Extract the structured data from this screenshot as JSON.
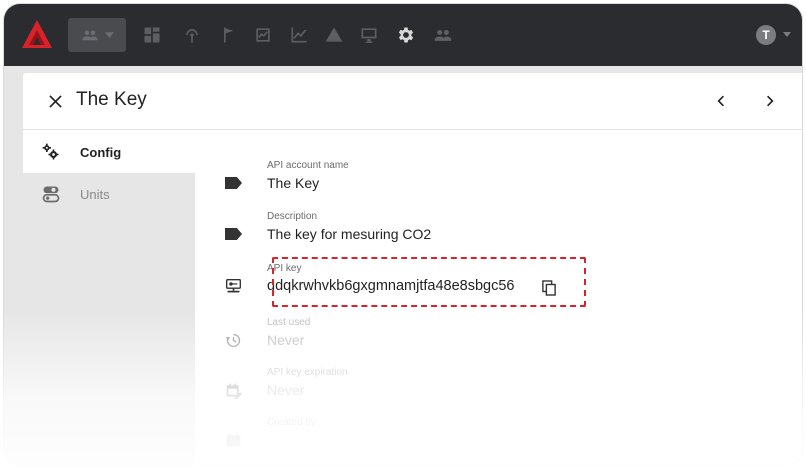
{
  "app": {
    "brand_color": "#d9232a",
    "topbar_color": "#2b2c2f"
  },
  "topbar": {
    "icons": [
      "users-dropdown-icon",
      "dashboard-icon",
      "sensors-icon",
      "flag-icon",
      "chart-box-icon",
      "line-chart-icon",
      "alert-icon",
      "monitor-icon",
      "settings-icon",
      "people-icon"
    ],
    "user_initial": "T"
  },
  "panel": {
    "title": "The Key"
  },
  "sidebar": {
    "items": [
      {
        "label": "Config",
        "icon": "cogs-icon",
        "active": true
      },
      {
        "label": "Units",
        "icon": "toggles-icon",
        "active": false
      }
    ]
  },
  "fields": {
    "account_name": {
      "label": "API account name",
      "value": "The Key",
      "icon": "tag-icon"
    },
    "description": {
      "label": "Description",
      "value": "The key for mesuring CO2",
      "icon": "tag-icon"
    },
    "api_key": {
      "label": "API key",
      "value": "qdqkrwhvkb6gxgmnamjtfa48e8sbgc56",
      "icon": "api-key-icon"
    },
    "last_used": {
      "label": "Last used",
      "value": "Never",
      "icon": "history-icon"
    },
    "expiration": {
      "label": "API key expiration",
      "value": "Never",
      "icon": "calendar-edit-icon"
    },
    "created_by": {
      "label": "Created by",
      "value": "",
      "icon": "calendar-icon"
    }
  }
}
